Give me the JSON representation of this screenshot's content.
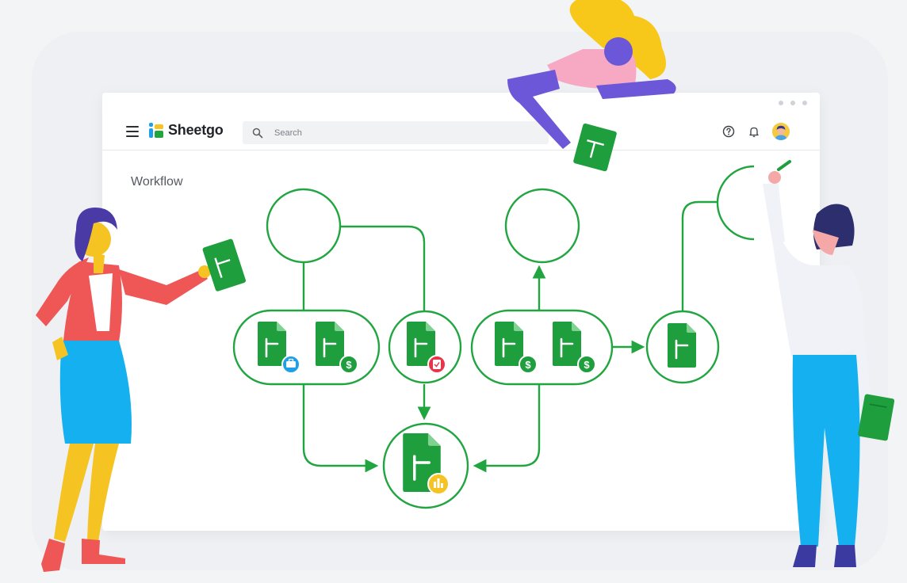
{
  "app": {
    "name": "Sheetgo"
  },
  "search": {
    "placeholder": "Search"
  },
  "page": {
    "title": "Workflow"
  },
  "header_icons": [
    "help-icon",
    "bell-icon",
    "user-avatar"
  ],
  "brand_colors": {
    "green": "#1f9e3e",
    "line_green": "#21a540",
    "yellow": "#f5c422",
    "blue": "#1ea0e8",
    "red": "#e8344a"
  },
  "workflow": {
    "file_groups": [
      {
        "files": 2,
        "badges": [
          "briefcase-badge-icon",
          "dollar-badge-icon"
        ]
      },
      {
        "files": 1,
        "badges": [
          "clipboard-badge-icon"
        ]
      },
      {
        "files": 2,
        "badges": [
          "dollar-badge-icon",
          "dollar-badge-icon"
        ]
      },
      {
        "files": 1,
        "badges": []
      },
      {
        "files": 1,
        "badges": [
          "chart-badge-icon"
        ]
      }
    ],
    "empty_nodes": 3
  }
}
